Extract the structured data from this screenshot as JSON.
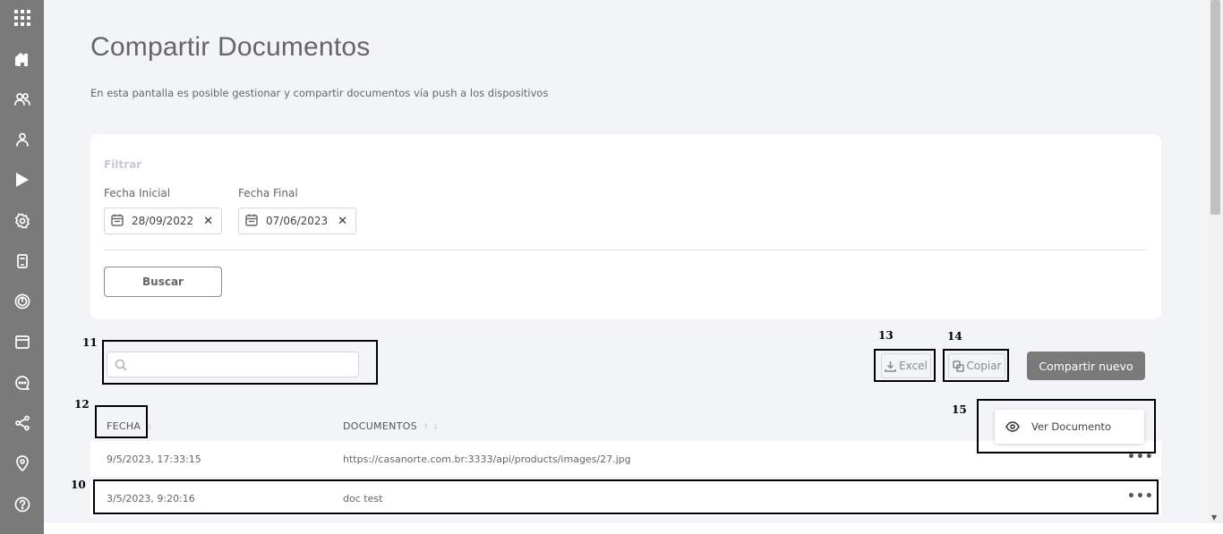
{
  "sidebar": {
    "items": [
      {
        "icon": "grid-icon"
      },
      {
        "icon": "home-icon"
      },
      {
        "icon": "users-icon"
      },
      {
        "icon": "user-icon"
      },
      {
        "icon": "play-icon"
      },
      {
        "icon": "gear-icon"
      },
      {
        "icon": "device-icon"
      },
      {
        "icon": "target-icon"
      },
      {
        "icon": "calendar-icon"
      },
      {
        "icon": "chat-icon"
      },
      {
        "icon": "share-icon"
      },
      {
        "icon": "location-icon"
      },
      {
        "icon": "help-icon"
      }
    ]
  },
  "page": {
    "title": "Compartir Documentos",
    "subtitle": "En esta pantalla es posible gestionar y compartir documentos vía push a los dispositivos"
  },
  "filter": {
    "title": "Filtrar",
    "start_label": "Fecha Inicial",
    "start_value": "28/09/2022",
    "end_label": "Fecha Final",
    "end_value": "07/06/2023",
    "clear_glyph": "✕",
    "search_button": "Buscar"
  },
  "toolbar": {
    "search_placeholder": "",
    "excel_label": "Excel",
    "copy_label": "Copiar",
    "new_label": "Compartir nuevo"
  },
  "table": {
    "columns": [
      "FECHA",
      "DOCUMENTOS"
    ],
    "sort_glyph_1": "↓",
    "sort_glyph_2": "↑ ↓",
    "rows": [
      {
        "fecha": "9/5/2023, 17:33:15",
        "documento": "https://casanorte.com.br:3333/api/products/images/27.jpg"
      },
      {
        "fecha": "3/5/2023, 9:20:16",
        "documento": "doc test"
      }
    ],
    "more_glyph": "•••"
  },
  "menu": {
    "view_label": "Ver Documento"
  },
  "annotations": [
    "10",
    "11",
    "12",
    "13",
    "14",
    "15"
  ],
  "colors": {
    "sidebar": "#7a7a7a",
    "background": "#f3f4f7",
    "primary_button": "#7a7a7a"
  }
}
